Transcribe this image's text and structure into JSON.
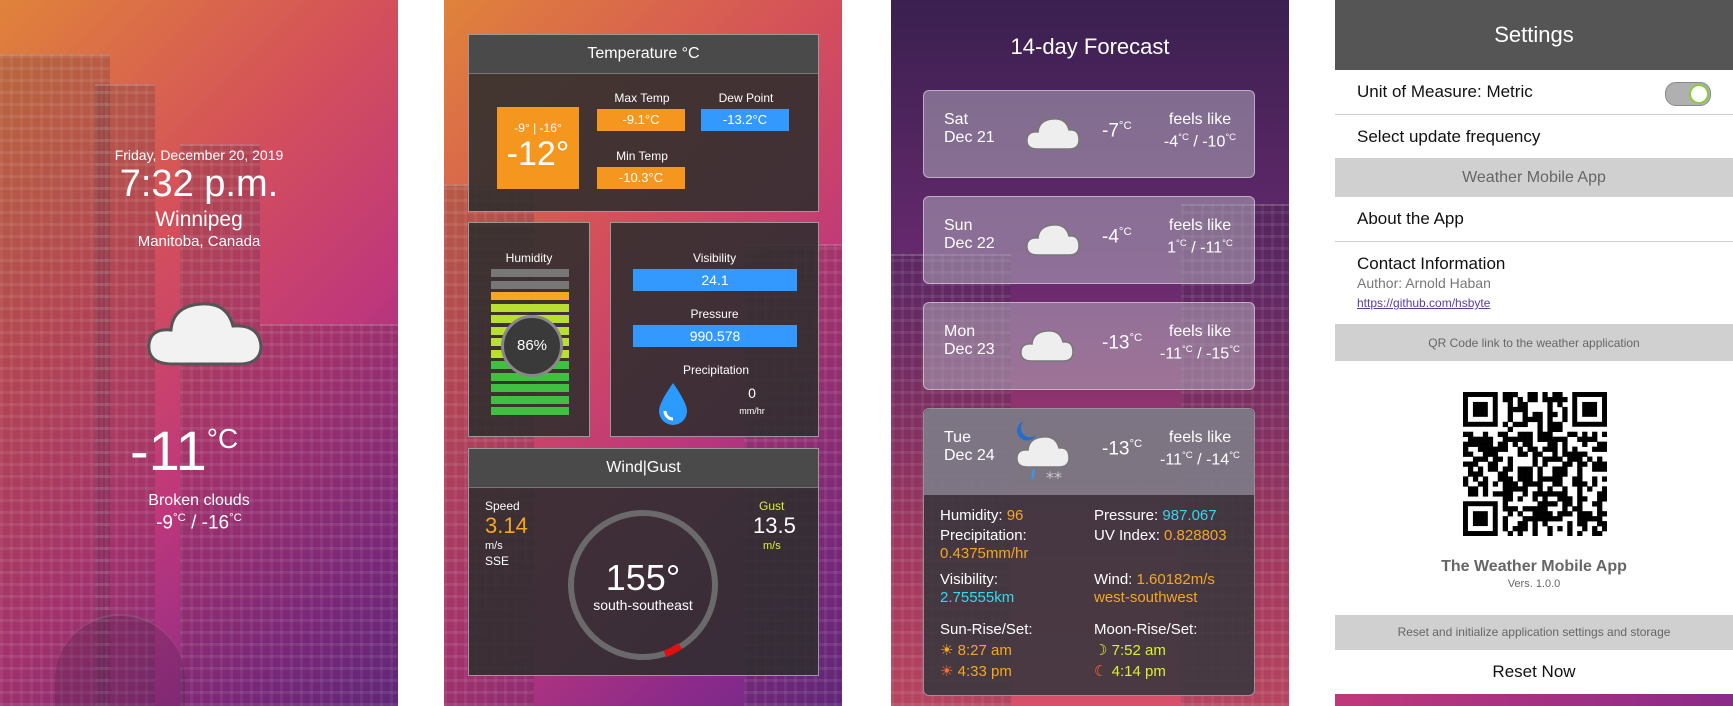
{
  "current": {
    "date": "Friday, December 20, 2019",
    "time": "7:32 p.m.",
    "city": "Winnipeg",
    "region": "Manitoba, Canada",
    "temp": "-11",
    "unit": "°C",
    "condition": "Broken clouds",
    "hi": "-9",
    "lo": "-16"
  },
  "temperature": {
    "title": "Temperature °C",
    "range": "-9° | -16°",
    "current": "-12°",
    "max_label": "Max Temp",
    "max": "-9.1°C",
    "dew_label": "Dew Point",
    "dew": "-13.2°C",
    "min_label": "Min Temp",
    "min": "-10.3°C"
  },
  "humidity": {
    "label": "Humidity",
    "value": "86%",
    "fraction": 0.86
  },
  "visibility": {
    "label": "Visibility",
    "value": "24.1"
  },
  "pressure": {
    "label": "Pressure",
    "value": "990.578"
  },
  "precipitation": {
    "label": "Precipitation",
    "value": "0",
    "unit": "mm/hr"
  },
  "wind": {
    "title": "Wind|Gust",
    "speed_label": "Speed",
    "speed": "3.14",
    "speed_unit": "m/s",
    "dir_abbr": "SSE",
    "gust_label": "Gust",
    "gust": "13.5",
    "gust_unit": "m/s",
    "degrees": "155°",
    "dir_name": "south-southeast"
  },
  "forecast": {
    "title": "14-day Forecast",
    "feels_label": "feels like",
    "days": [
      {
        "day": "Sat",
        "date": "Dec 21",
        "temp": "-7",
        "hi": "-4",
        "lo": "-10"
      },
      {
        "day": "Sun",
        "date": "Dec 22",
        "temp": "-4",
        "hi": "1",
        "lo": "-11"
      },
      {
        "day": "Mon",
        "date": "Dec 23",
        "temp": "-13",
        "hi": "-11",
        "lo": "-15"
      },
      {
        "day": "Tue",
        "date": "Dec 24",
        "temp": "-13",
        "hi": "-11",
        "lo": "-14"
      }
    ],
    "unit": "°C",
    "detail": {
      "humidity_label": "Humidity:",
      "humidity": "96",
      "pressure_label": "Pressure:",
      "pressure": "987.067",
      "precip_label": "Precipitation:",
      "precip": "0.4375mm/hr",
      "uv_label": "UV Index:",
      "uv": "0.828803",
      "vis_label": "Visibility:",
      "vis": "2.75555km",
      "wind_label": "Wind:",
      "wind": "1.60182m/s",
      "wind_dir": "west-southwest",
      "sun_label": "Sun-Rise/Set:",
      "sunrise": "8:27 am",
      "sunset": "4:33 pm",
      "moon_label": "Moon-Rise/Set:",
      "moonrise": "7:52 am",
      "moonset": "4:14 pm"
    }
  },
  "settings": {
    "title": "Settings",
    "unit_label": "Unit of Measure: Metric",
    "update_label": "Select update frequency",
    "app_section": "Weather Mobile App",
    "about": "About the App",
    "contact": "Contact Information",
    "author": "Author: Arnold Haban",
    "link": "https://github.com/hsbyte",
    "qr_section": "QR Code link to the weather application",
    "app_name": "The Weather Mobile App",
    "version": "Vers. 1.0.0",
    "reset_section": "Reset and initialize application settings and storage",
    "reset": "Reset Now"
  },
  "colors": {
    "orange": "#f5961e",
    "blue": "#3399ff",
    "cyan": "#35d8f0",
    "yellow": "#f5a623",
    "lime": "#d8f035"
  }
}
